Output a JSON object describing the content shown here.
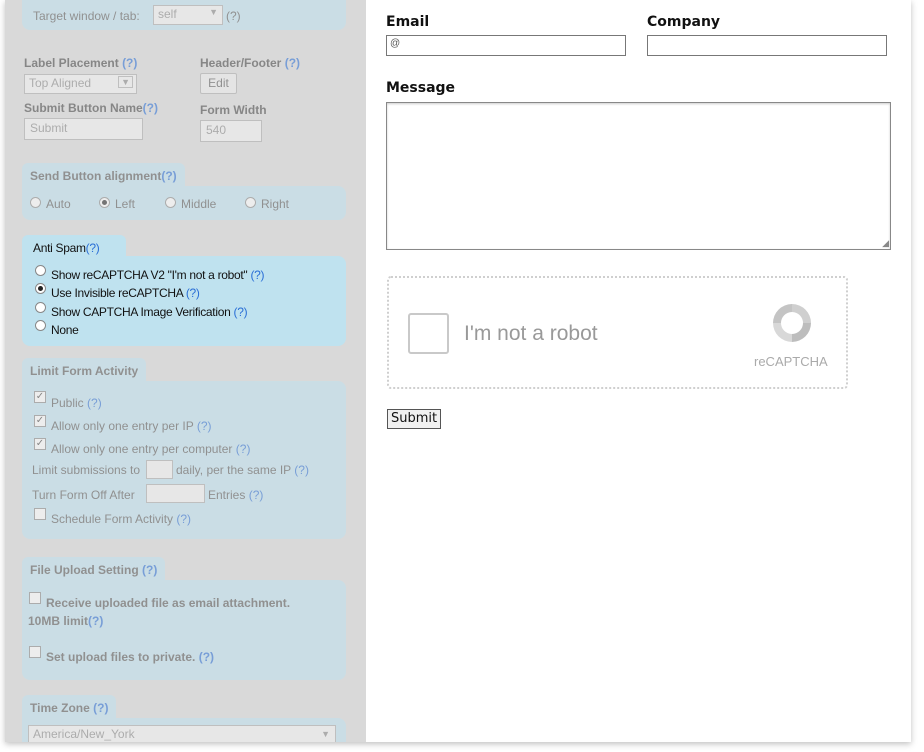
{
  "left": {
    "target": {
      "label": "Target window / tab:",
      "value": "self",
      "help": "(?)"
    },
    "label_placement": {
      "label": "Label Placement",
      "help": "(?)",
      "value": "Top Aligned"
    },
    "header_footer": {
      "label": "Header/Footer",
      "help": "(?)",
      "button": "Edit"
    },
    "submit_name": {
      "label": "Submit Button Name",
      "help": "(?)",
      "value": "Submit"
    },
    "form_width": {
      "label": "Form Width",
      "value": "540"
    },
    "send_alignment": {
      "title": "Send Button alignment",
      "help": "(?)",
      "options": [
        "Auto",
        "Left",
        "Middle",
        "Right"
      ],
      "selected": "Left"
    },
    "anti_spam": {
      "title": "Anti Spam",
      "help": "(?)",
      "options": [
        {
          "label": "Show reCAPTCHA V2 \"I'm not a robot\"",
          "help": "(?)",
          "selected": false
        },
        {
          "label": "Use Invisible reCAPTCHA",
          "help": "(?)",
          "selected": true
        },
        {
          "label": "Show CAPTCHA Image Verification",
          "help": "(?)",
          "selected": false
        },
        {
          "label": "None",
          "help": "",
          "selected": false
        }
      ]
    },
    "limit": {
      "title": "Limit Form Activity",
      "public": "Public",
      "one_ip": "Allow only one entry per IP",
      "one_computer": "Allow only one entry per computer",
      "limit_prefix": "Limit submissions to",
      "limit_suffix": "daily, per the same IP",
      "off_prefix": "Turn Form Off After",
      "off_suffix": "Entries",
      "schedule": "Schedule Form Activity",
      "help": "(?)"
    },
    "upload": {
      "title": "File Upload Setting",
      "help": "(?)",
      "attach_line1": "Receive uploaded file as email attachment.",
      "attach_line2": "10MB limit",
      "private": "Set upload files to private."
    },
    "timezone": {
      "title": "Time Zone",
      "help": "(?)",
      "value": "America/New_York"
    }
  },
  "form": {
    "email_label": "Email",
    "email_value": "@",
    "company_label": "Company",
    "company_value": "",
    "message_label": "Message",
    "captcha_text": "I'm not a robot",
    "captcha_brand": "reCAPTCHA",
    "submit_label": "Submit"
  },
  "colors": {
    "panel_bg": "#d9d9d9",
    "section_bg": "#bfe2ef",
    "help_link": "#2a6fd6"
  }
}
